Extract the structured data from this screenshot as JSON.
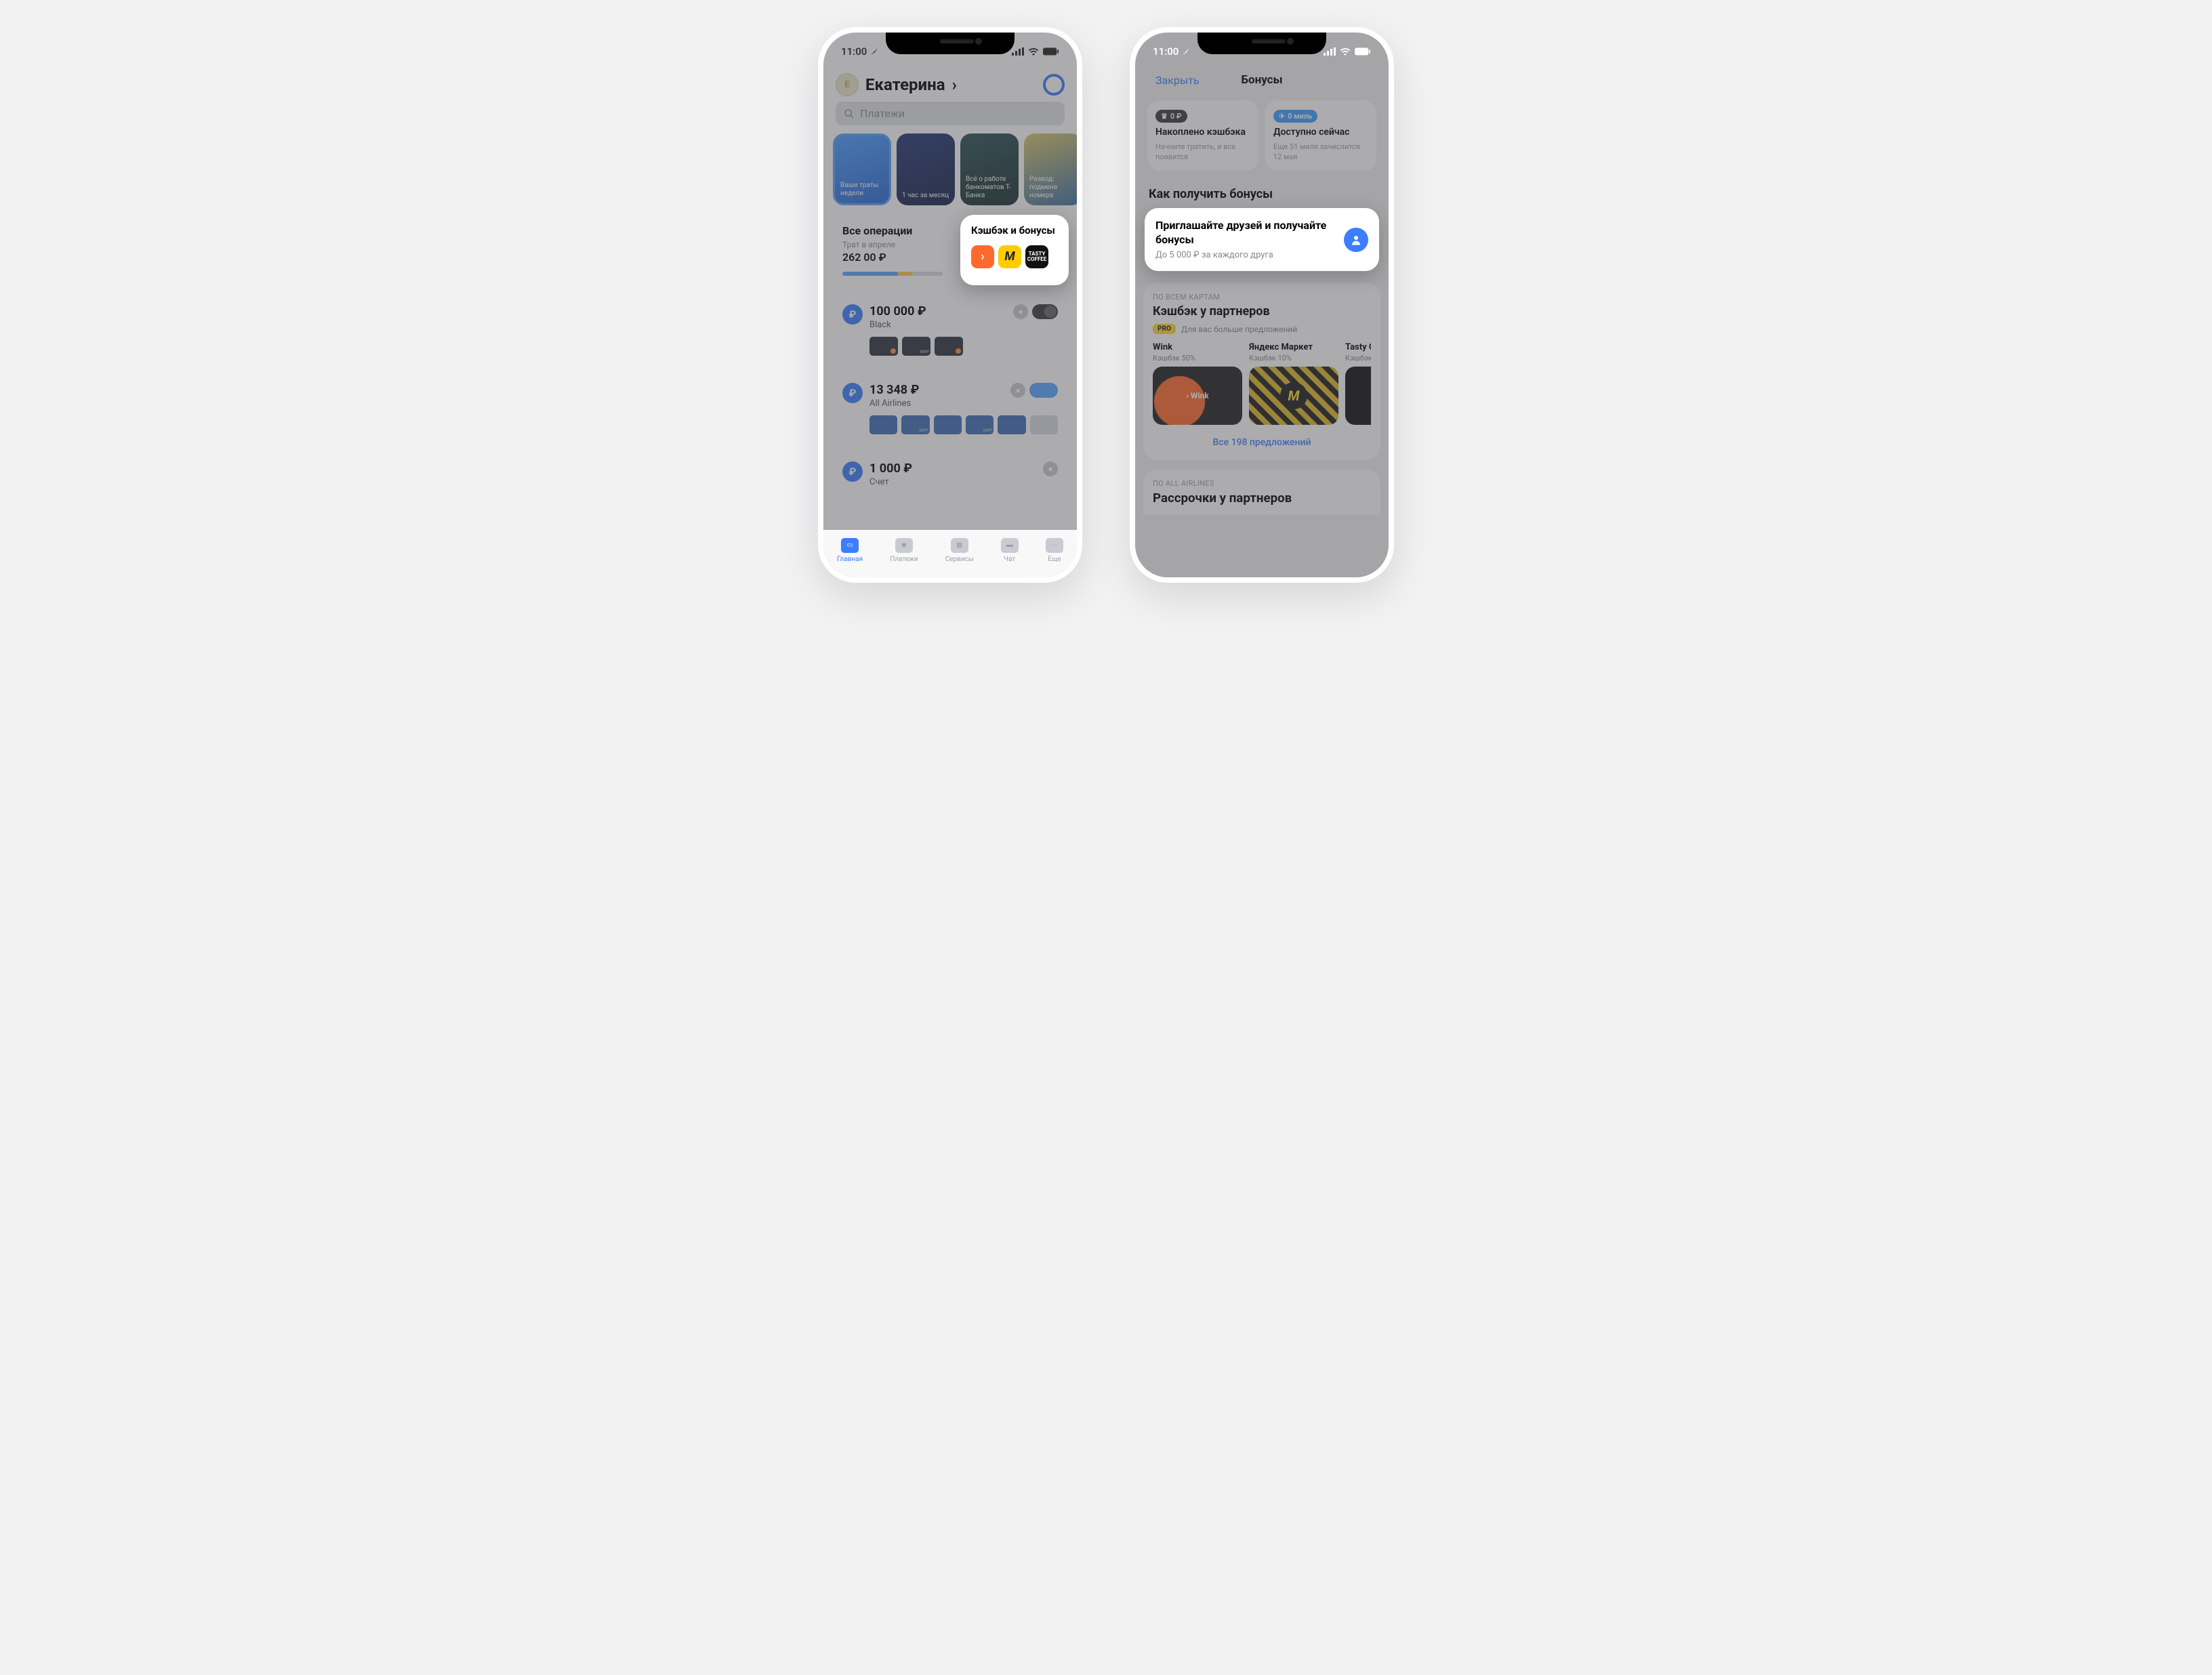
{
  "status": {
    "time": "11:00"
  },
  "phone1": {
    "user_name": "Екатерина",
    "avatar_initial": "E",
    "search_placeholder": "Платежи",
    "stories": {
      "s1": "Ваши траты недели",
      "s2": "1 час за месяц",
      "s3": "Всё о работе банкоматов Т-Банка",
      "s4": "Развод: подмена номера"
    },
    "operations": {
      "title": "Все операции",
      "sub": "Трат в апреле",
      "amount": "262 00 ₽"
    },
    "cashback": {
      "title": "Кэшбэк и бонусы"
    },
    "accounts": {
      "a1": {
        "balance": "100 000 ₽",
        "name": "Black"
      },
      "a2": {
        "balance": "13 348 ₽",
        "name": "All Airlines"
      },
      "a3": {
        "balance": "1 000 ₽",
        "name": "Счет"
      }
    },
    "tabs": {
      "t1": "Главная",
      "t2": "Платежи",
      "t3": "Сервисы",
      "t4": "Чат",
      "t5": "Еще"
    }
  },
  "phone2": {
    "close": "Закрыть",
    "title": "Бонусы",
    "stat1": {
      "badge": "0 ₽",
      "title": "Накоплено кэшбэка",
      "sub": "Начните тратить, и все появится"
    },
    "stat2": {
      "badge": "0 миль",
      "title": "Доступно сейчас",
      "sub": "Еще 51 миля зачислится 12 мая"
    },
    "section1": "Как получить бонусы",
    "invite": {
      "title": "Приглашайте друзей и получайте бонусы",
      "sub": "До 5 000 ₽ за каждого друга"
    },
    "partners": {
      "over": "ПО ВСЕМ КАРТАМ",
      "title": "Кэшбэк у партнеров",
      "pro": "PRO",
      "pro_text": "Для вас больше предложений",
      "offers": {
        "o1": {
          "name": "Wink",
          "cb": "Кэшбэк 50%"
        },
        "o2": {
          "name": "Яндекс Маркет",
          "cb": "Кэшбэк 10%"
        },
        "o3": {
          "name": "Tasty C",
          "cb": "Кэшбэк"
        }
      },
      "all": "Все 198 предложений"
    },
    "partners2": {
      "over": "ПО ALL AIRLINES",
      "title": "Рассрочки у партнеров"
    }
  }
}
